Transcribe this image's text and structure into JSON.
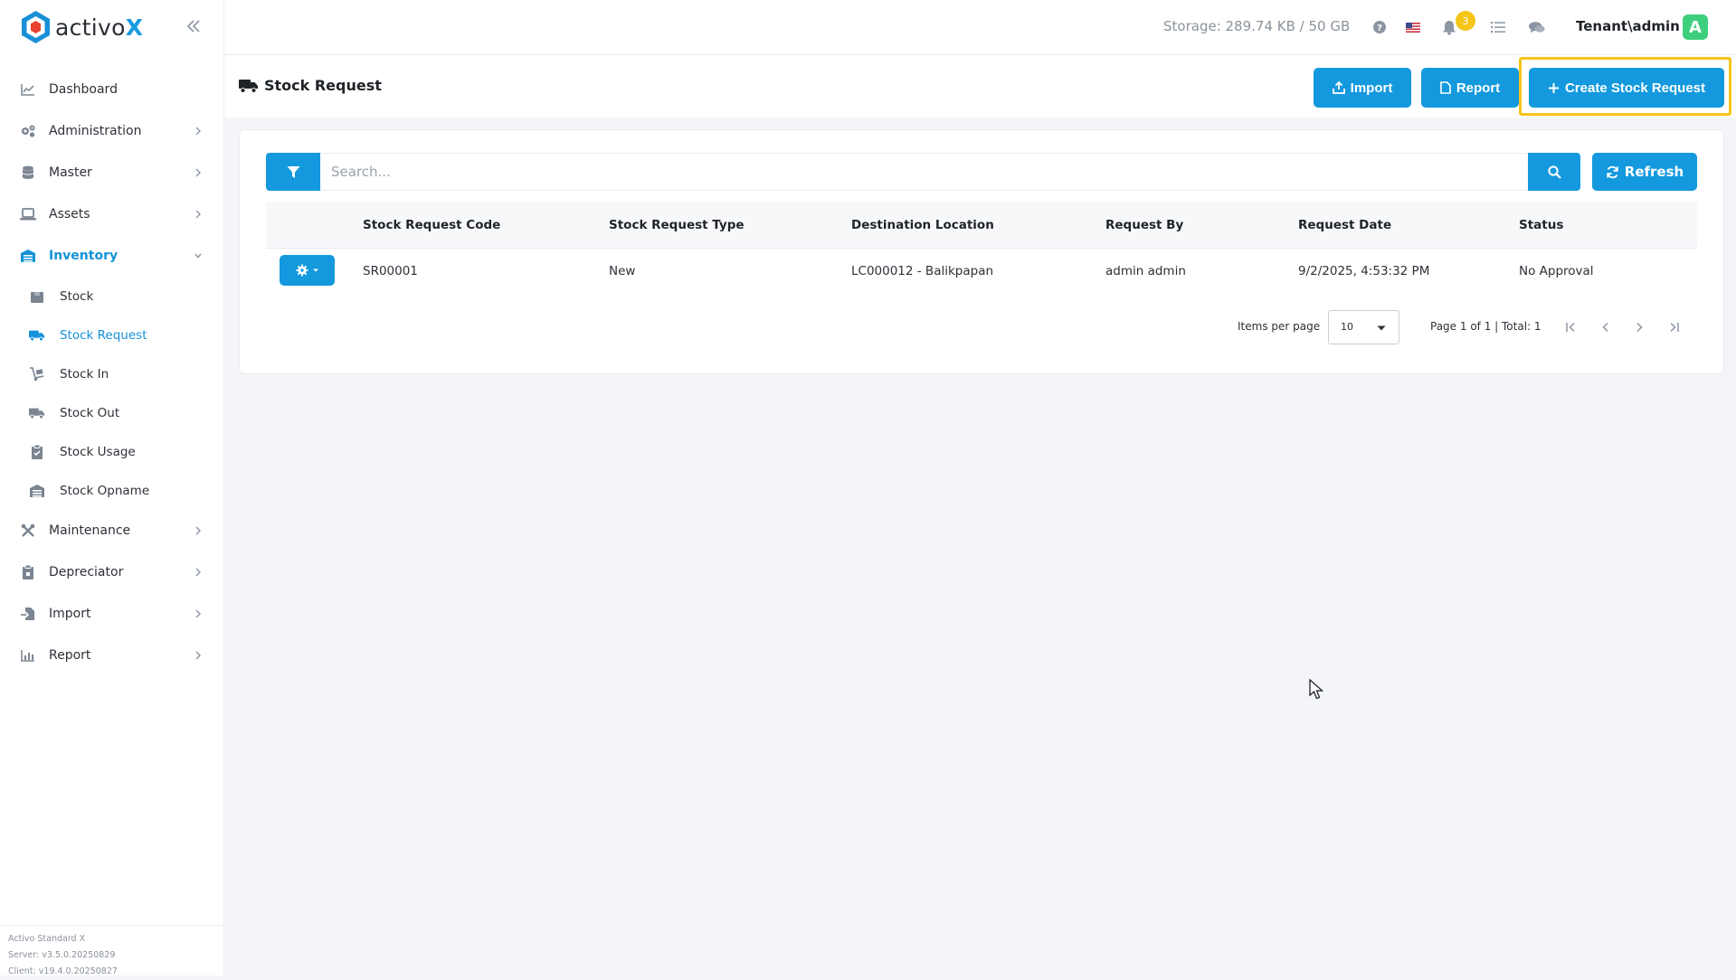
{
  "app": {
    "logo_text": "activo",
    "logo_x": "X"
  },
  "sidebar": {
    "items": [
      {
        "label": "Dashboard",
        "icon": "chart-line-icon"
      },
      {
        "label": "Administration",
        "icon": "cogs-icon"
      },
      {
        "label": "Master",
        "icon": "database-icon"
      },
      {
        "label": "Assets",
        "icon": "laptop-icon"
      },
      {
        "label": "Inventory",
        "icon": "warehouse-icon"
      },
      {
        "label": "Maintenance",
        "icon": "tools-icon"
      },
      {
        "label": "Depreciator",
        "icon": "clipboard-icon"
      },
      {
        "label": "Import",
        "icon": "file-import-icon"
      },
      {
        "label": "Report",
        "icon": "bar-chart-icon"
      }
    ],
    "inventory_sub": [
      {
        "label": "Stock",
        "icon": "box-icon"
      },
      {
        "label": "Stock Request",
        "icon": "truck-icon"
      },
      {
        "label": "Stock In",
        "icon": "dolly-icon"
      },
      {
        "label": "Stock Out",
        "icon": "truck-loading-icon"
      },
      {
        "label": "Stock Usage",
        "icon": "clipboard-check-icon"
      },
      {
        "label": "Stock Opname",
        "icon": "warehouse-icon"
      }
    ],
    "footer": {
      "product": "Activo Standard X",
      "server": "Server: v3.5.0.20250829",
      "client": "Client: v19.4.0.20250827"
    }
  },
  "topbar": {
    "storage": "Storage: 289.74 KB / 50 GB",
    "notification_count": "3",
    "user": "Tenant\\admin",
    "avatar_letter": "A"
  },
  "page": {
    "title": "Stock Request",
    "buttons": {
      "import": "Import",
      "report": "Report",
      "create": "Create Stock Request"
    }
  },
  "search": {
    "placeholder": "Search...",
    "refresh_label": "Refresh"
  },
  "table": {
    "columns": [
      "Stock Request Code",
      "Stock Request Type",
      "Destination Location",
      "Request By",
      "Request Date",
      "Status"
    ],
    "rows": [
      {
        "code": "SR00001",
        "type": "New",
        "destination": "LC000012 - Balikpapan",
        "request_by": "admin admin",
        "request_date": "9/2/2025, 4:53:32 PM",
        "status": "No Approval"
      }
    ]
  },
  "pagination": {
    "items_per_page_label": "Items per page",
    "items_per_page": "10",
    "summary": "Page 1 of 1 | Total: 1"
  },
  "colors": {
    "primary": "#1499de",
    "highlight": "#f5c518",
    "avatar": "#3ecf7e"
  }
}
